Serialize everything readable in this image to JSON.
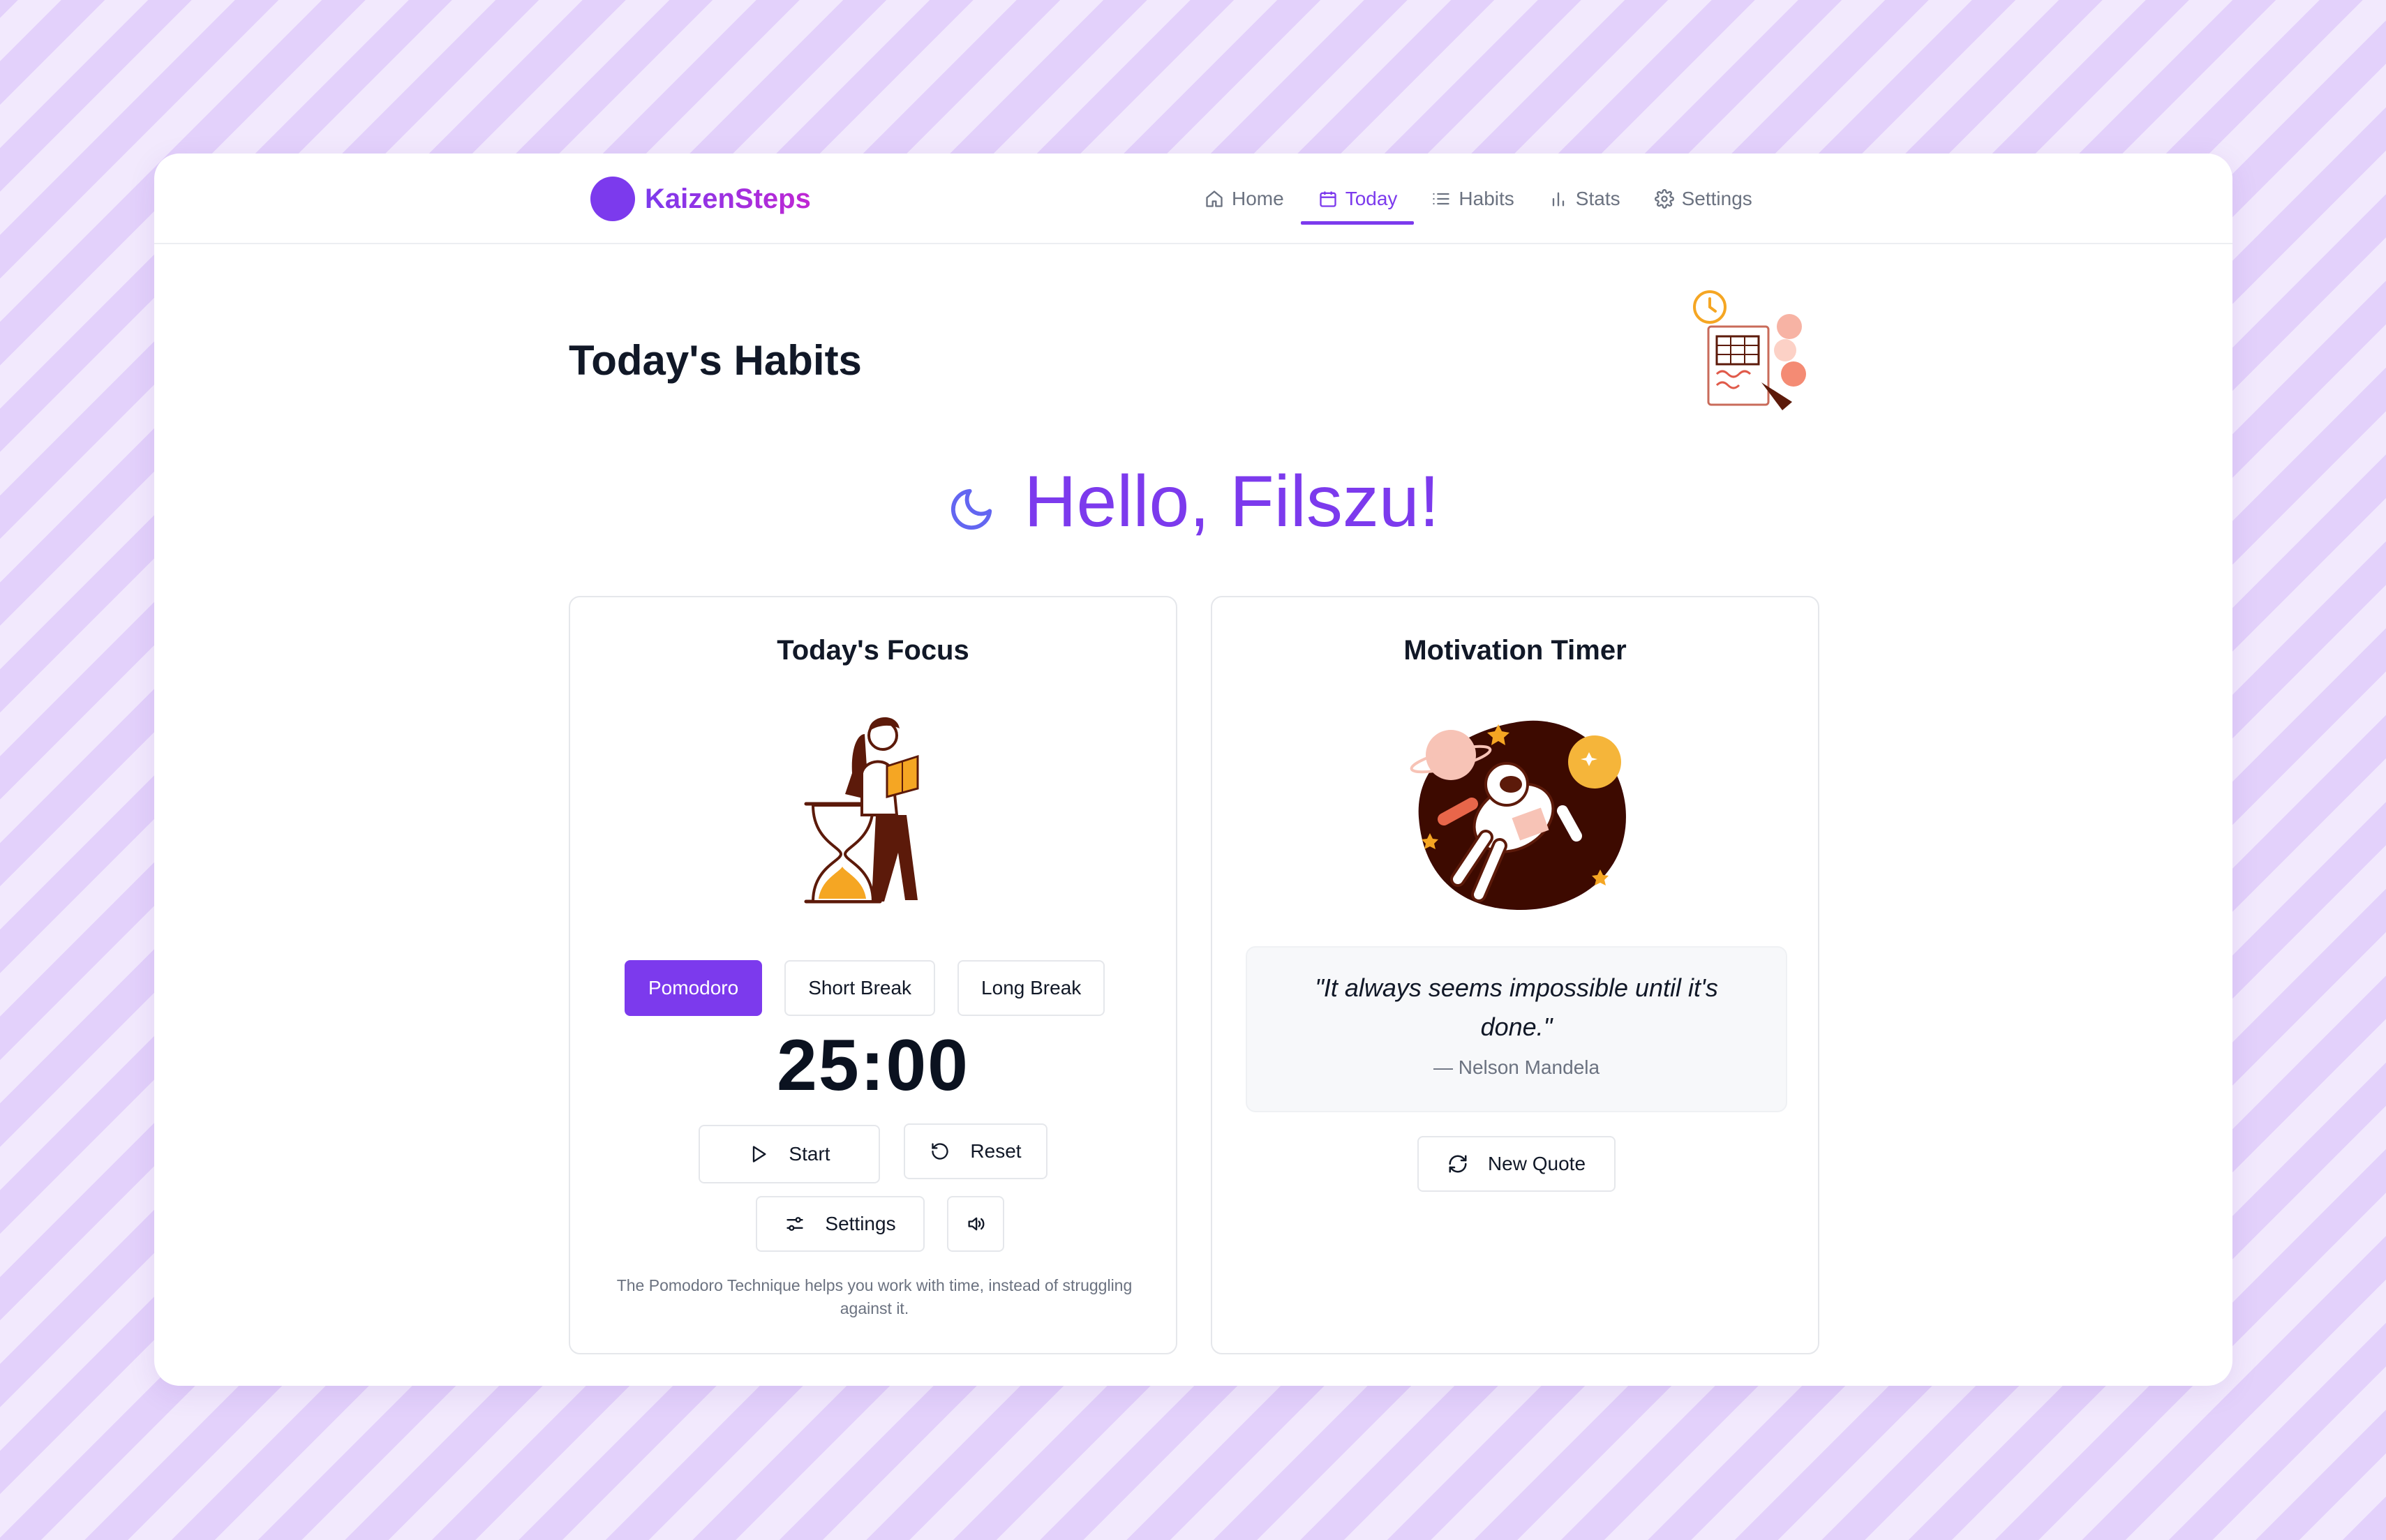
{
  "app": {
    "brand_name": "KaizenSteps",
    "accent_color": "#7c3aed"
  },
  "nav": {
    "items": [
      {
        "label": "Home",
        "icon": "home-icon",
        "active": false
      },
      {
        "label": "Today",
        "icon": "calendar-icon",
        "active": true
      },
      {
        "label": "Habits",
        "icon": "list-icon",
        "active": false
      },
      {
        "label": "Stats",
        "icon": "bar-chart-icon",
        "active": false
      },
      {
        "label": "Settings",
        "icon": "gear-icon",
        "active": false
      }
    ]
  },
  "page": {
    "title": "Today's Habits",
    "greeting": "Hello, Filszu!",
    "greeting_icon": "moon-icon"
  },
  "focus_card": {
    "title": "Today's Focus",
    "modes": [
      {
        "label": "Pomodoro",
        "active": true
      },
      {
        "label": "Short Break",
        "active": false
      },
      {
        "label": "Long Break",
        "active": false
      }
    ],
    "timer": "25:00",
    "start_label": "Start",
    "reset_label": "Reset",
    "settings_label": "Settings",
    "description": "The Pomodoro Technique helps you work with time, instead of struggling against it."
  },
  "motivation_card": {
    "title": "Motivation Timer",
    "quote": "\"It always seems impossible until it's done.\"",
    "author": "— Nelson Mandela",
    "new_quote_label": "New Quote"
  }
}
